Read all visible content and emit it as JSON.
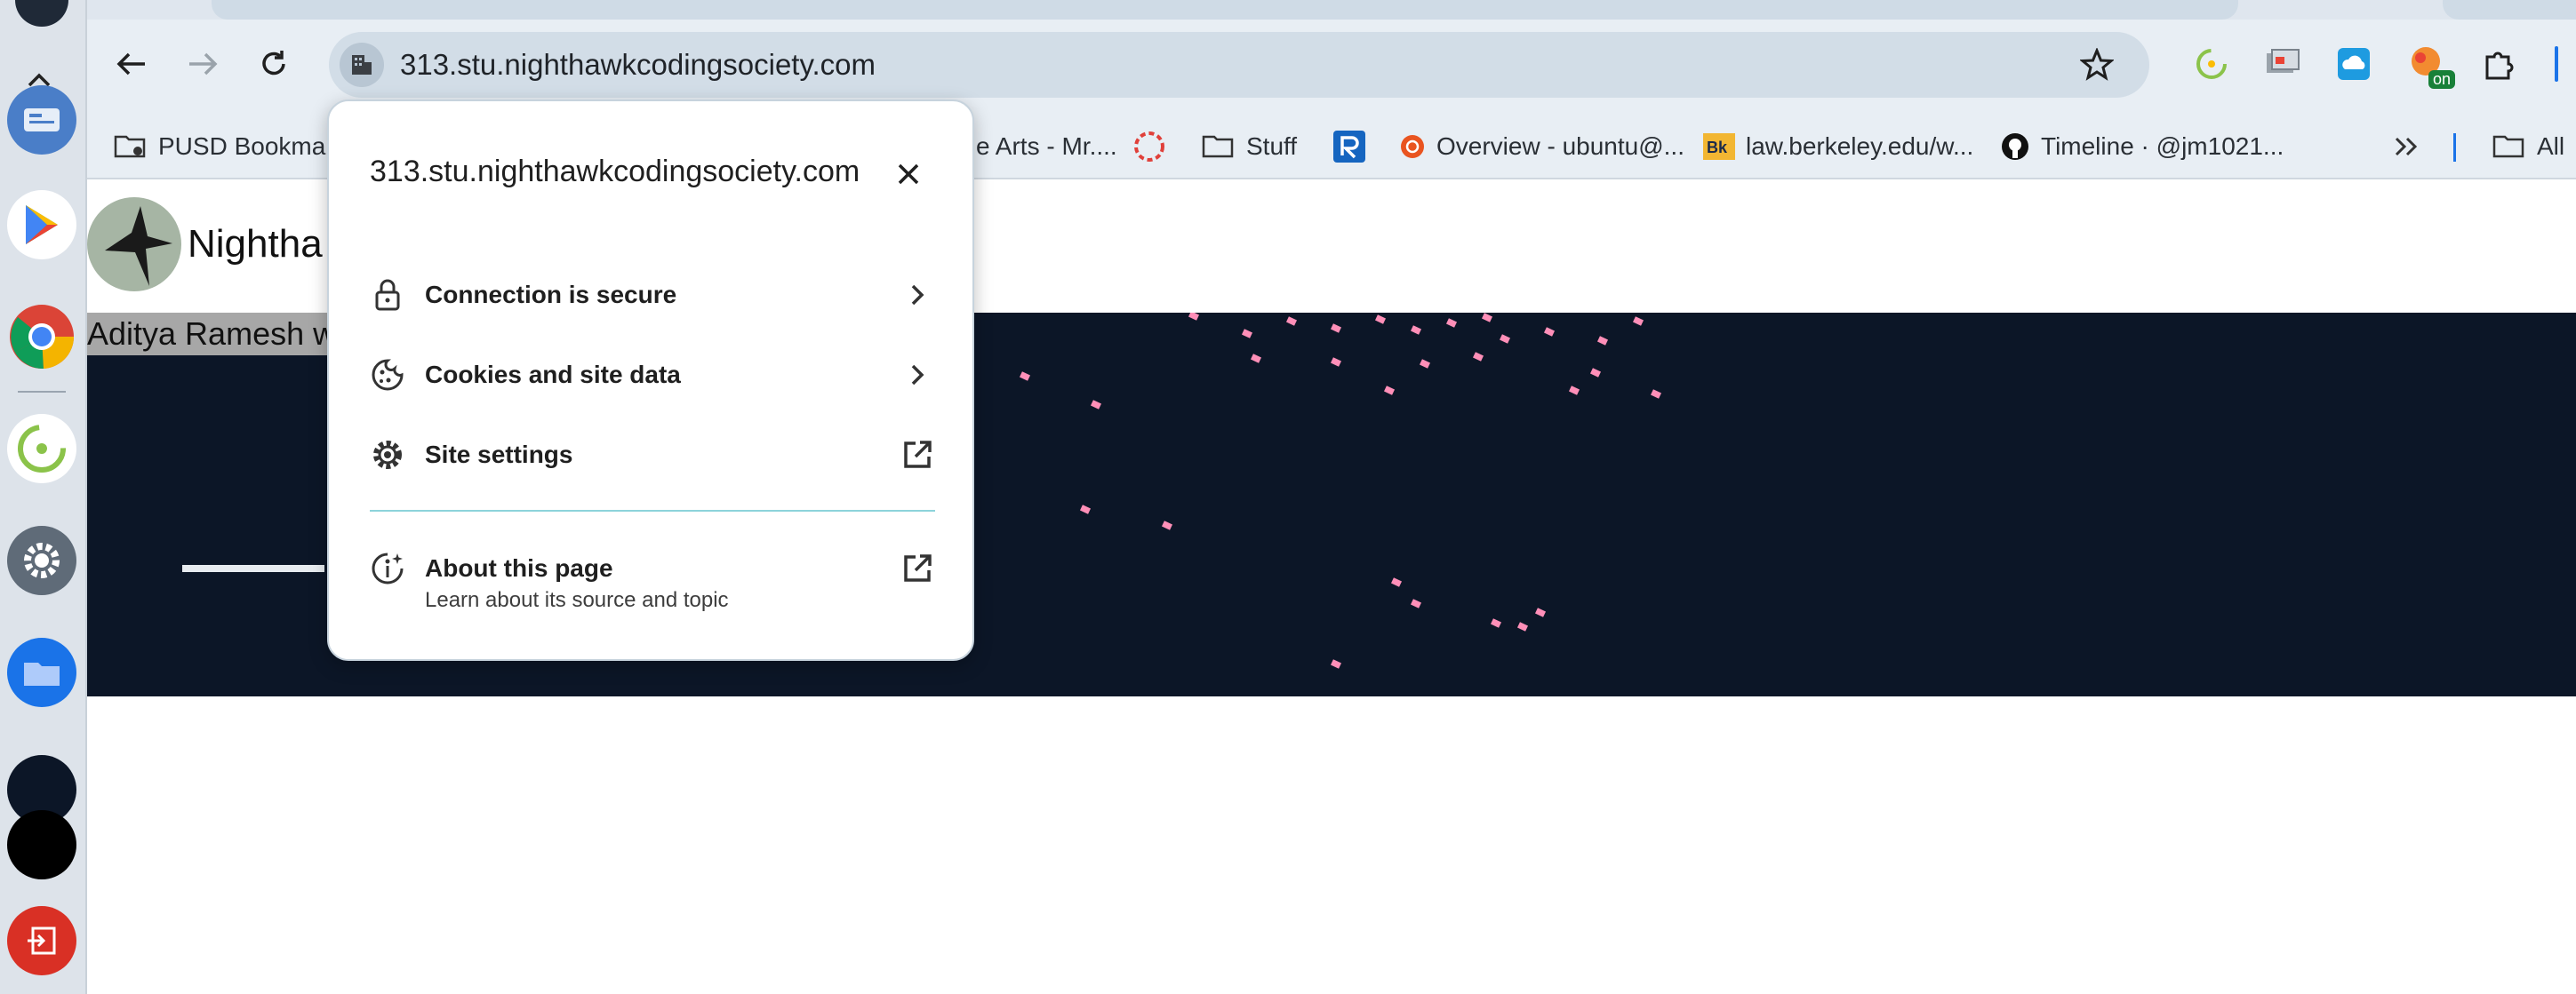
{
  "browser": {
    "url": "313.stu.nighthawkcodingsociety.com",
    "icons": [
      "back-icon",
      "forward-icon",
      "reload-icon",
      "site-info-icon",
      "bookmark-star-icon"
    ],
    "extensions": [
      "timer-extension-icon",
      "screencast-extension-icon",
      "cloud-extension-icon",
      "on-extension-icon",
      "extensions-puzzle-icon"
    ],
    "extension_badge": "on"
  },
  "bookmarks": [
    {
      "label": "PUSD Bookmar",
      "icon": "managed-folder-icon"
    },
    {
      "label": "e Arts - Mr....",
      "icon": ""
    },
    {
      "label": "",
      "icon": "dotted-circle-icon"
    },
    {
      "label": "Stuff",
      "icon": "folder-icon"
    },
    {
      "label": "",
      "icon": "r-logo-icon"
    },
    {
      "label": "Overview - ubuntu@...",
      "icon": "ubuntu-icon"
    },
    {
      "label": "law.berkeley.edu/w...",
      "icon": "bk-icon"
    },
    {
      "label": "Timeline · @jm1021...",
      "icon": "github-icon"
    },
    {
      "label": "",
      "icon": "more-bookmarks-icon"
    },
    {
      "label": "All",
      "icon": "folder-icon"
    }
  ],
  "page": {
    "brand": "Nightha",
    "caption": "Aditya Ramesh w"
  },
  "popup": {
    "title": "313.stu.nighthawkcodingsociety.com",
    "connection_label": "Connection is secure",
    "cookies_label": "Cookies and site data",
    "site_settings_label": "Site settings",
    "about_label": "About this page",
    "about_sub": "Learn about its source and topic"
  },
  "colors": {
    "hero_bg": "#0c1627",
    "confetti": "#ff8fb8",
    "separator": "#8dd3db"
  }
}
